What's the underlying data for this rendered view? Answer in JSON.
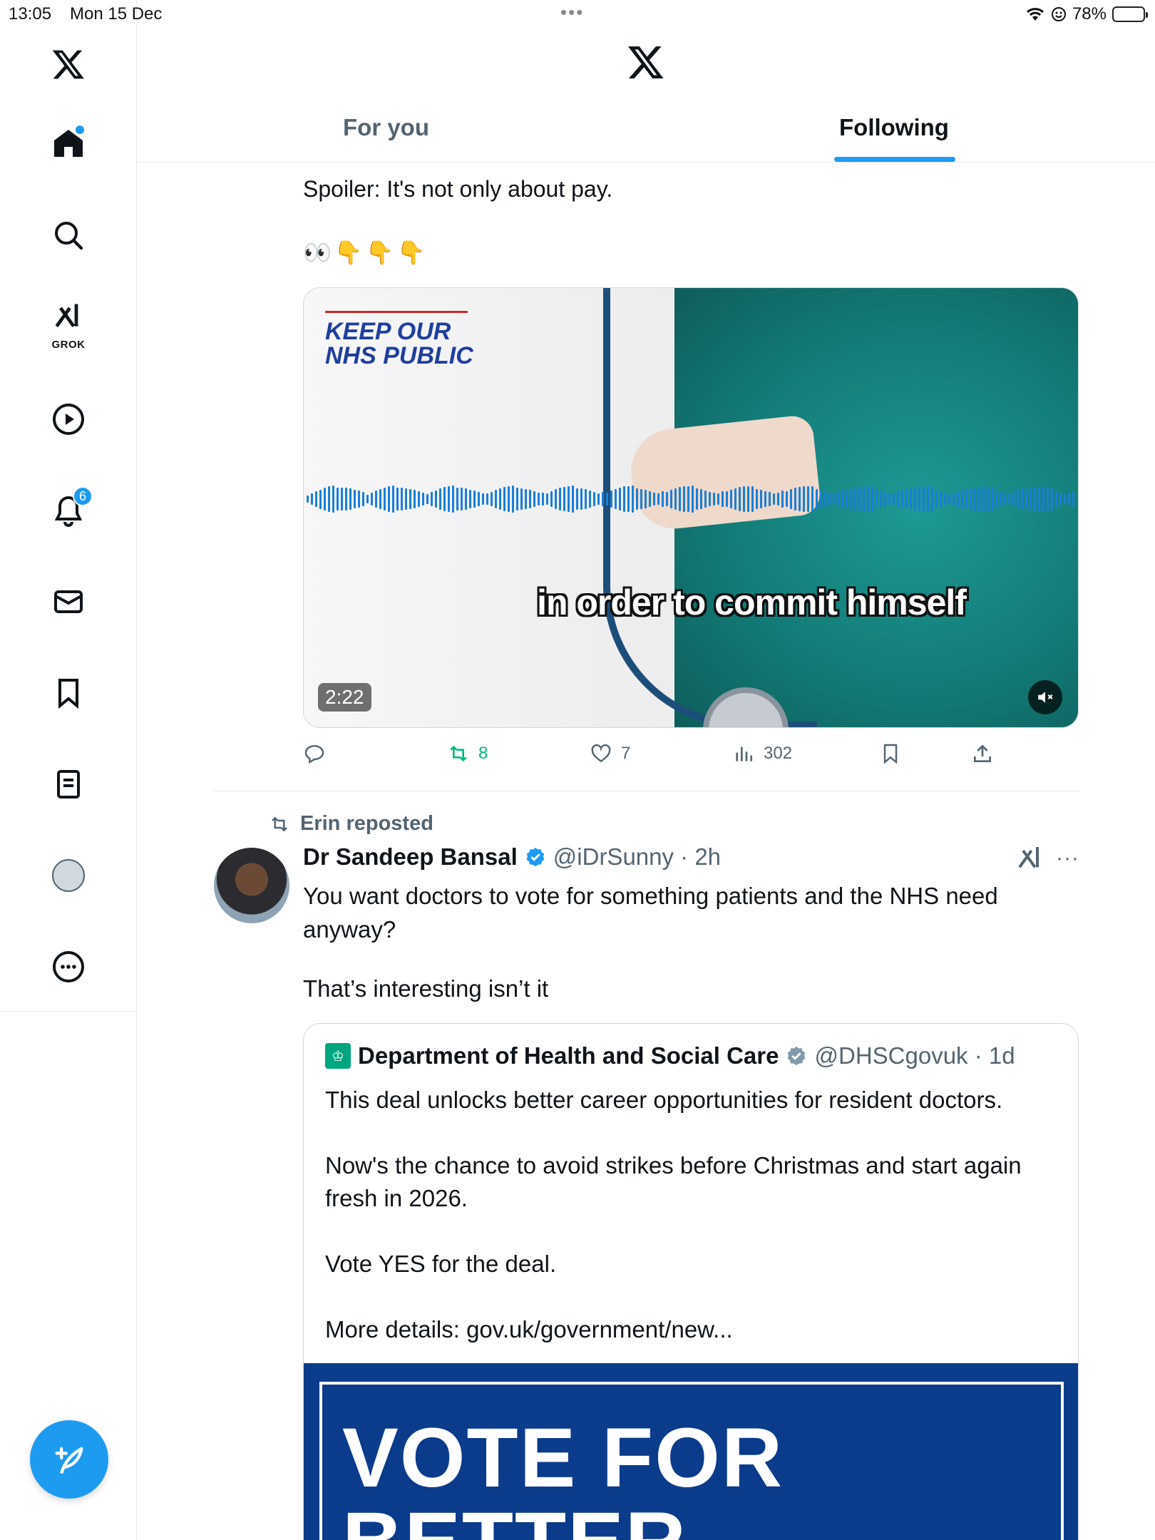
{
  "status_bar": {
    "time": "13:05",
    "date": "Mon 15 Dec",
    "battery": "78%"
  },
  "sidebar": {
    "grok_label": "GROK",
    "notifications_badge": "6"
  },
  "header": {
    "tabs": [
      {
        "label": "For you",
        "selected": false
      },
      {
        "label": "Following",
        "selected": true
      }
    ]
  },
  "tweet1": {
    "text": "Spoiler: It's not only about pay.",
    "emoji": "👀👇👇👇",
    "media": {
      "logo_line1": "KEEP OUR",
      "logo_line2": "NHS PUBLIC",
      "caption": "in order to commit himself",
      "duration": "2:22"
    },
    "actions": {
      "retweets": "8",
      "likes": "7",
      "views": "302"
    }
  },
  "tweet2": {
    "reposted_by": "Erin reposted",
    "author_name": "Dr Sandeep Bansal",
    "handle_time": "@iDrSunny · 2h",
    "body_line1": "You want doctors to vote for something patients and the NHS need anyway?",
    "body_line2": "That’s interesting isn’t it",
    "quote": {
      "author_name": "Department of Health and Social Care",
      "handle_time": "@DHSCgovuk · 1d",
      "paragraphs": [
        "This deal unlocks better career opportunities for resident doctors.",
        "Now's the chance to avoid strikes before Christmas and start again fresh in 2026.",
        "Vote YES for the deal.",
        "More details: gov.uk/government/new..."
      ],
      "image_line1": "VOTE FOR",
      "image_line2": "BETTER"
    }
  },
  "colors": {
    "accent": "#1d9bf0",
    "retweet_green": "#00ba7c",
    "secondary_text": "#536471"
  }
}
